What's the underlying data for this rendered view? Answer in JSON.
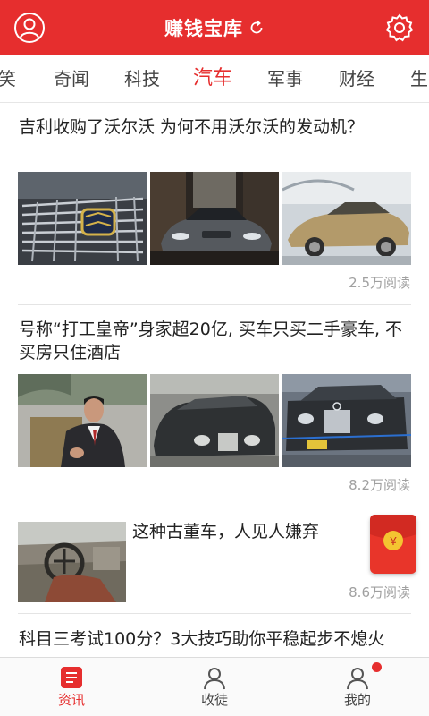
{
  "header": {
    "title": "赚钱宝库",
    "profile_icon": "user-icon",
    "settings_icon": "gear-icon",
    "refresh_icon": "refresh-icon",
    "color": "#e62e2e"
  },
  "tabs": {
    "items": [
      "笑",
      "奇闻",
      "科技",
      "汽车",
      "军事",
      "财经",
      "生"
    ],
    "active": "汽车",
    "active_color": "#e62e2e"
  },
  "articles": [
    {
      "title": "吉利收购了沃尔沃 为何不用沃尔沃的发动机？",
      "reads": "2.5万阅读",
      "thumbnails": [
        "geely-grille-photo",
        "volvo-concept-photo",
        "gold-concept-car-photo"
      ]
    },
    {
      "title": "号称“打工皇帝”身家超20亿, 买车只买二手豪车, 不买房只住酒店",
      "reads": "8.2万阅读",
      "thumbnails": [
        "businessman-photo",
        "rolls-royce-photo",
        "mercedes-photo"
      ]
    },
    {
      "title": "这种古董车，人见人嫌弃",
      "reads": "8.6万阅读",
      "thumbnails": [
        "old-car-interior-photo"
      ],
      "badge": {
        "icon": "red-packet-icon",
        "symbol": "¥"
      }
    },
    {
      "title": "科目三考试100分？3大技巧助你平稳起步不熄火"
    }
  ],
  "bottom_nav": {
    "items": [
      {
        "label": "资讯",
        "icon": "news-icon",
        "active": true
      },
      {
        "label": "收徒",
        "icon": "apprentice-icon",
        "active": false
      },
      {
        "label": "我的",
        "icon": "profile-icon",
        "active": false,
        "badge": "red-dot"
      }
    ]
  }
}
